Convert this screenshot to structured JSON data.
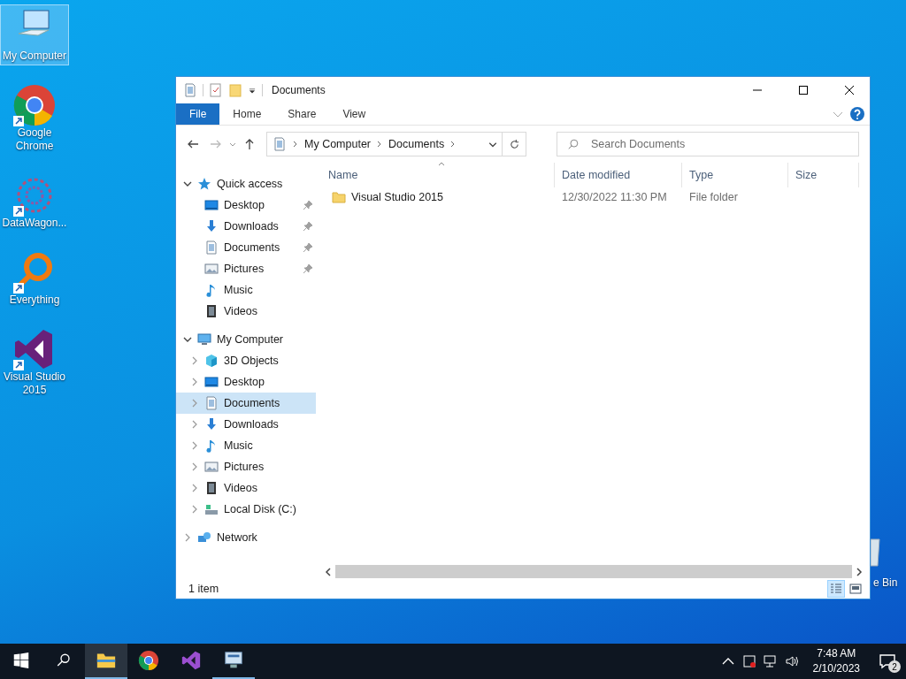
{
  "desktop_icons": [
    {
      "label": "My Computer",
      "kind": "computer",
      "selected": true,
      "shortcut": false
    },
    {
      "label": "Google Chrome",
      "kind": "chrome",
      "selected": false,
      "shortcut": true
    },
    {
      "label": "DataWagon...",
      "kind": "datawagon",
      "selected": false,
      "shortcut": true
    },
    {
      "label": "Everything",
      "kind": "everything",
      "selected": false,
      "shortcut": true
    },
    {
      "label": "Visual Studio 2015",
      "kind": "vs",
      "selected": false,
      "shortcut": true
    }
  ],
  "recycle_bin": {
    "label": "e Bin"
  },
  "window": {
    "title": "Documents",
    "ribbon_tabs": [
      {
        "label": "File",
        "selected": true
      },
      {
        "label": "Home",
        "selected": false
      },
      {
        "label": "Share",
        "selected": false
      },
      {
        "label": "View",
        "selected": false
      }
    ],
    "address": {
      "crumbs": [
        "My Computer",
        "Documents"
      ]
    },
    "search": {
      "placeholder": "Search Documents"
    },
    "nav": [
      {
        "label": "Quick access",
        "kind": "star",
        "expanded": true,
        "selected": false,
        "children": [
          {
            "label": "Desktop",
            "kind": "desktop",
            "pinned": true,
            "selected": false
          },
          {
            "label": "Downloads",
            "kind": "download",
            "pinned": true,
            "selected": false
          },
          {
            "label": "Documents",
            "kind": "document",
            "pinned": true,
            "selected": false
          },
          {
            "label": "Pictures",
            "kind": "pictures",
            "pinned": true,
            "selected": false
          },
          {
            "label": "Music",
            "kind": "music",
            "pinned": false,
            "selected": false
          },
          {
            "label": "Videos",
            "kind": "videos",
            "pinned": false,
            "selected": false
          }
        ]
      },
      {
        "label": "My Computer",
        "kind": "computer",
        "expanded": true,
        "selected": false,
        "children": [
          {
            "label": "3D Objects",
            "kind": "cube",
            "expanded": false,
            "selected": false
          },
          {
            "label": "Desktop",
            "kind": "desktop",
            "expanded": false,
            "selected": false
          },
          {
            "label": "Documents",
            "kind": "document",
            "expanded": false,
            "selected": true
          },
          {
            "label": "Downloads",
            "kind": "download",
            "expanded": false,
            "selected": false
          },
          {
            "label": "Music",
            "kind": "music",
            "expanded": false,
            "selected": false
          },
          {
            "label": "Pictures",
            "kind": "pictures",
            "expanded": false,
            "selected": false
          },
          {
            "label": "Videos",
            "kind": "videos",
            "expanded": false,
            "selected": false
          },
          {
            "label": "Local Disk (C:)",
            "kind": "disk",
            "expanded": false,
            "selected": false
          }
        ]
      },
      {
        "label": "Network",
        "kind": "network",
        "expanded": false,
        "selected": false
      }
    ],
    "columns": [
      "Name",
      "Date modified",
      "Type",
      "Size"
    ],
    "rows": [
      {
        "name": "Visual Studio 2015",
        "date_modified": "12/30/2022 11:30 PM",
        "type": "File folder"
      }
    ],
    "status": "1 item",
    "views": [
      {
        "kind": "details",
        "selected": true
      },
      {
        "kind": "large_icons",
        "selected": false
      }
    ]
  },
  "taskbar": {
    "apps": [
      {
        "kind": "explorer",
        "active": true
      },
      {
        "kind": "chrome",
        "active": false
      },
      {
        "kind": "vs",
        "active": false
      },
      {
        "kind": "remote",
        "active": true
      }
    ],
    "time": "7:48 AM",
    "date": "2/10/2023",
    "notifications": "2"
  }
}
